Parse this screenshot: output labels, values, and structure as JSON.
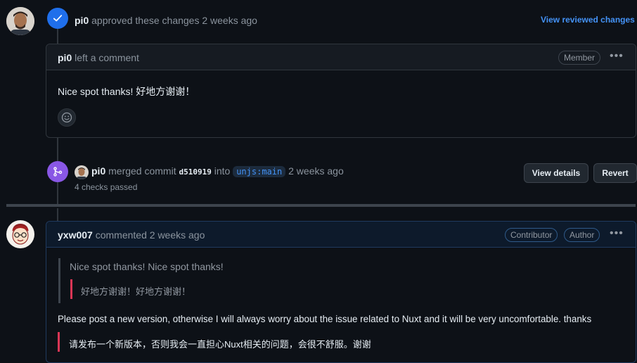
{
  "approval": {
    "user": "pi0",
    "action": "approved these changes",
    "time": "2 weeks ago",
    "link": "View reviewed changes"
  },
  "review_comment": {
    "user": "pi0",
    "action": "left a comment",
    "badge": "Member",
    "body": "Nice spot thanks! 好地方谢谢！"
  },
  "merge": {
    "user": "pi0",
    "action": "merged commit",
    "commit": "d510919",
    "into": "into",
    "branch": "unjs:main",
    "time": "2 weeks ago",
    "checks": "4 checks passed",
    "view_details": "View details",
    "revert": "Revert"
  },
  "comment": {
    "user": "yxw007",
    "action": "commented",
    "time": "2 weeks ago",
    "badges": [
      "Contributor",
      "Author"
    ],
    "quote": "Nice spot thanks! Nice spot thanks!",
    "nested_quote": "好地方谢谢！好地方谢谢！",
    "body": "Please post a new version, otherwise I will always worry about the issue related to Nuxt and it will be very uncomfortable. thanks",
    "body_cn": "请发布一个新版本，否则我会一直担心Nuxt相关的问题，会很不舒服。谢谢"
  },
  "colors": {
    "approve": "#1f6feb",
    "merge": "#8957e5",
    "accent_bar": "#da3655",
    "link": "#4493f8"
  }
}
